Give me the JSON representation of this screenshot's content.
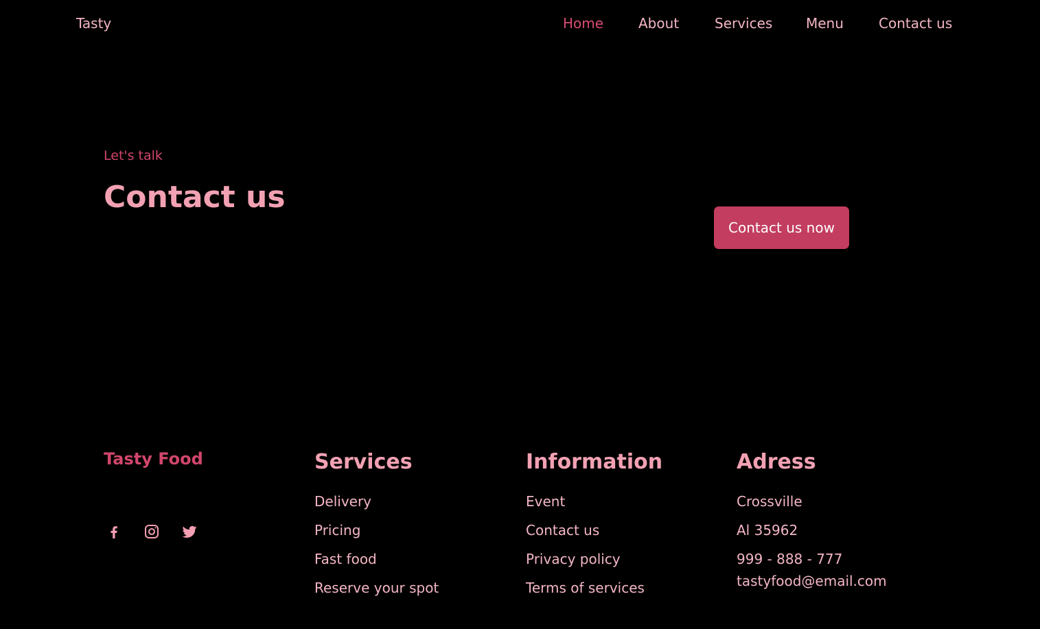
{
  "header": {
    "brand": "Tasty",
    "nav": [
      {
        "label": "Home",
        "active": true
      },
      {
        "label": "About"
      },
      {
        "label": "Services"
      },
      {
        "label": "Menu"
      },
      {
        "label": "Contact us"
      }
    ]
  },
  "hero": {
    "eyebrow": "Let's talk",
    "title": "Contact us",
    "cta_label": "Contact us now"
  },
  "footer": {
    "brand": "Tasty Food",
    "socials": [
      "facebook-icon",
      "instagram-icon",
      "twitter-icon"
    ],
    "services": {
      "title": "Services",
      "items": [
        "Delivery",
        "Pricing",
        "Fast food",
        "Reserve your spot"
      ]
    },
    "information": {
      "title": "Information",
      "items": [
        "Event",
        "Contact us",
        "Privacy policy",
        "Terms of services"
      ]
    },
    "address": {
      "title": "Adress",
      "items": [
        "Crossville",
        "Al 35962",
        "999 - 888 - 777",
        "tastyfood@email.com"
      ]
    }
  },
  "colors": {
    "background": "#000000",
    "accent": "#c23d5f",
    "heading_pink": "#f2a1b3",
    "text_pink": "#f3b6c4",
    "active_pink": "#d94c72"
  }
}
